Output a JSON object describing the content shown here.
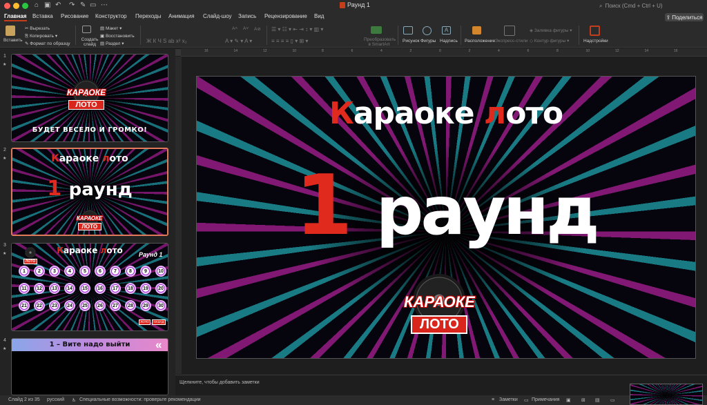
{
  "window": {
    "title": "Раунд 1"
  },
  "search": {
    "placeholder": "Поиск (Cmd + Ctrl + U)"
  },
  "tabs": [
    "Главная",
    "Вставка",
    "Рисование",
    "Конструктор",
    "Переходы",
    "Анимация",
    "Слайд-шоу",
    "Запись",
    "Рецензирование",
    "Вид"
  ],
  "share_label": "Поделиться",
  "ribbon": {
    "paste": "Вставить",
    "cut": "Вырезать",
    "copy": "Копировать",
    "format": "Формат по образцу",
    "create_slide": "Создать слайд",
    "layout": "Макет",
    "restore": "Восстановить",
    "section": "Раздел",
    "smartart": "Преобразовать в SmartArt",
    "picture": "Рисунок",
    "shapes": "Фигуры",
    "textbox": "Надпись",
    "arrange": "Расположение",
    "quickstyles": "Экспресс-стили",
    "fill": "Заливка фигуры",
    "outline": "Контур фигуры",
    "addins": "Надстройки"
  },
  "ruler_ticks": [
    "16",
    "14",
    "12",
    "10",
    "8",
    "6",
    "4",
    "2",
    "0",
    "2",
    "4",
    "6",
    "8",
    "10",
    "12",
    "14",
    "16"
  ],
  "slides": [
    {
      "num": "1",
      "subtitle": "БУДЕТ ВЕСЕЛО И ГРОМКО!"
    },
    {
      "num": "2",
      "title_first": "К",
      "title_mid": "араоке ",
      "title_l": "л",
      "title_rest": "ото",
      "round_num": "1",
      "round_word": "раунд"
    },
    {
      "num": "3",
      "title_first": "К",
      "title_mid": "араоке ",
      "title_l": "л",
      "title_rest": "ото",
      "round_label": "Раунд 1",
      "balls": [
        "1",
        "2",
        "3",
        "4",
        "5",
        "6",
        "7",
        "8",
        "9",
        "10",
        "11",
        "12",
        "13",
        "14",
        "15",
        "16",
        "17",
        "18",
        "19",
        "20",
        "21",
        "22",
        "23",
        "24",
        "25",
        "26",
        "27",
        "28",
        "29",
        "30"
      ],
      "btn_loto": "ЛОТО",
      "btn_back": "НАЗАД"
    },
    {
      "num": "4",
      "title": "1 – Вите надо выйти",
      "arrow": "«"
    }
  ],
  "logo": {
    "karaoke": "КАРАОКЕ",
    "loto": "ЛОТО"
  },
  "main_slide": {
    "title_first": "К",
    "title_mid": "араоке ",
    "title_l": "л",
    "title_rest": "ото",
    "round_num": "1",
    "round_word": "раунд"
  },
  "notes_placeholder": "Щелкните, чтобы добавить заметки",
  "status": {
    "slide": "Слайд 2 из 35",
    "language": "русский",
    "accessibility": "Специальные возможности: проверьте рекомендации",
    "notes": "Заметки",
    "comments": "Примечания"
  }
}
